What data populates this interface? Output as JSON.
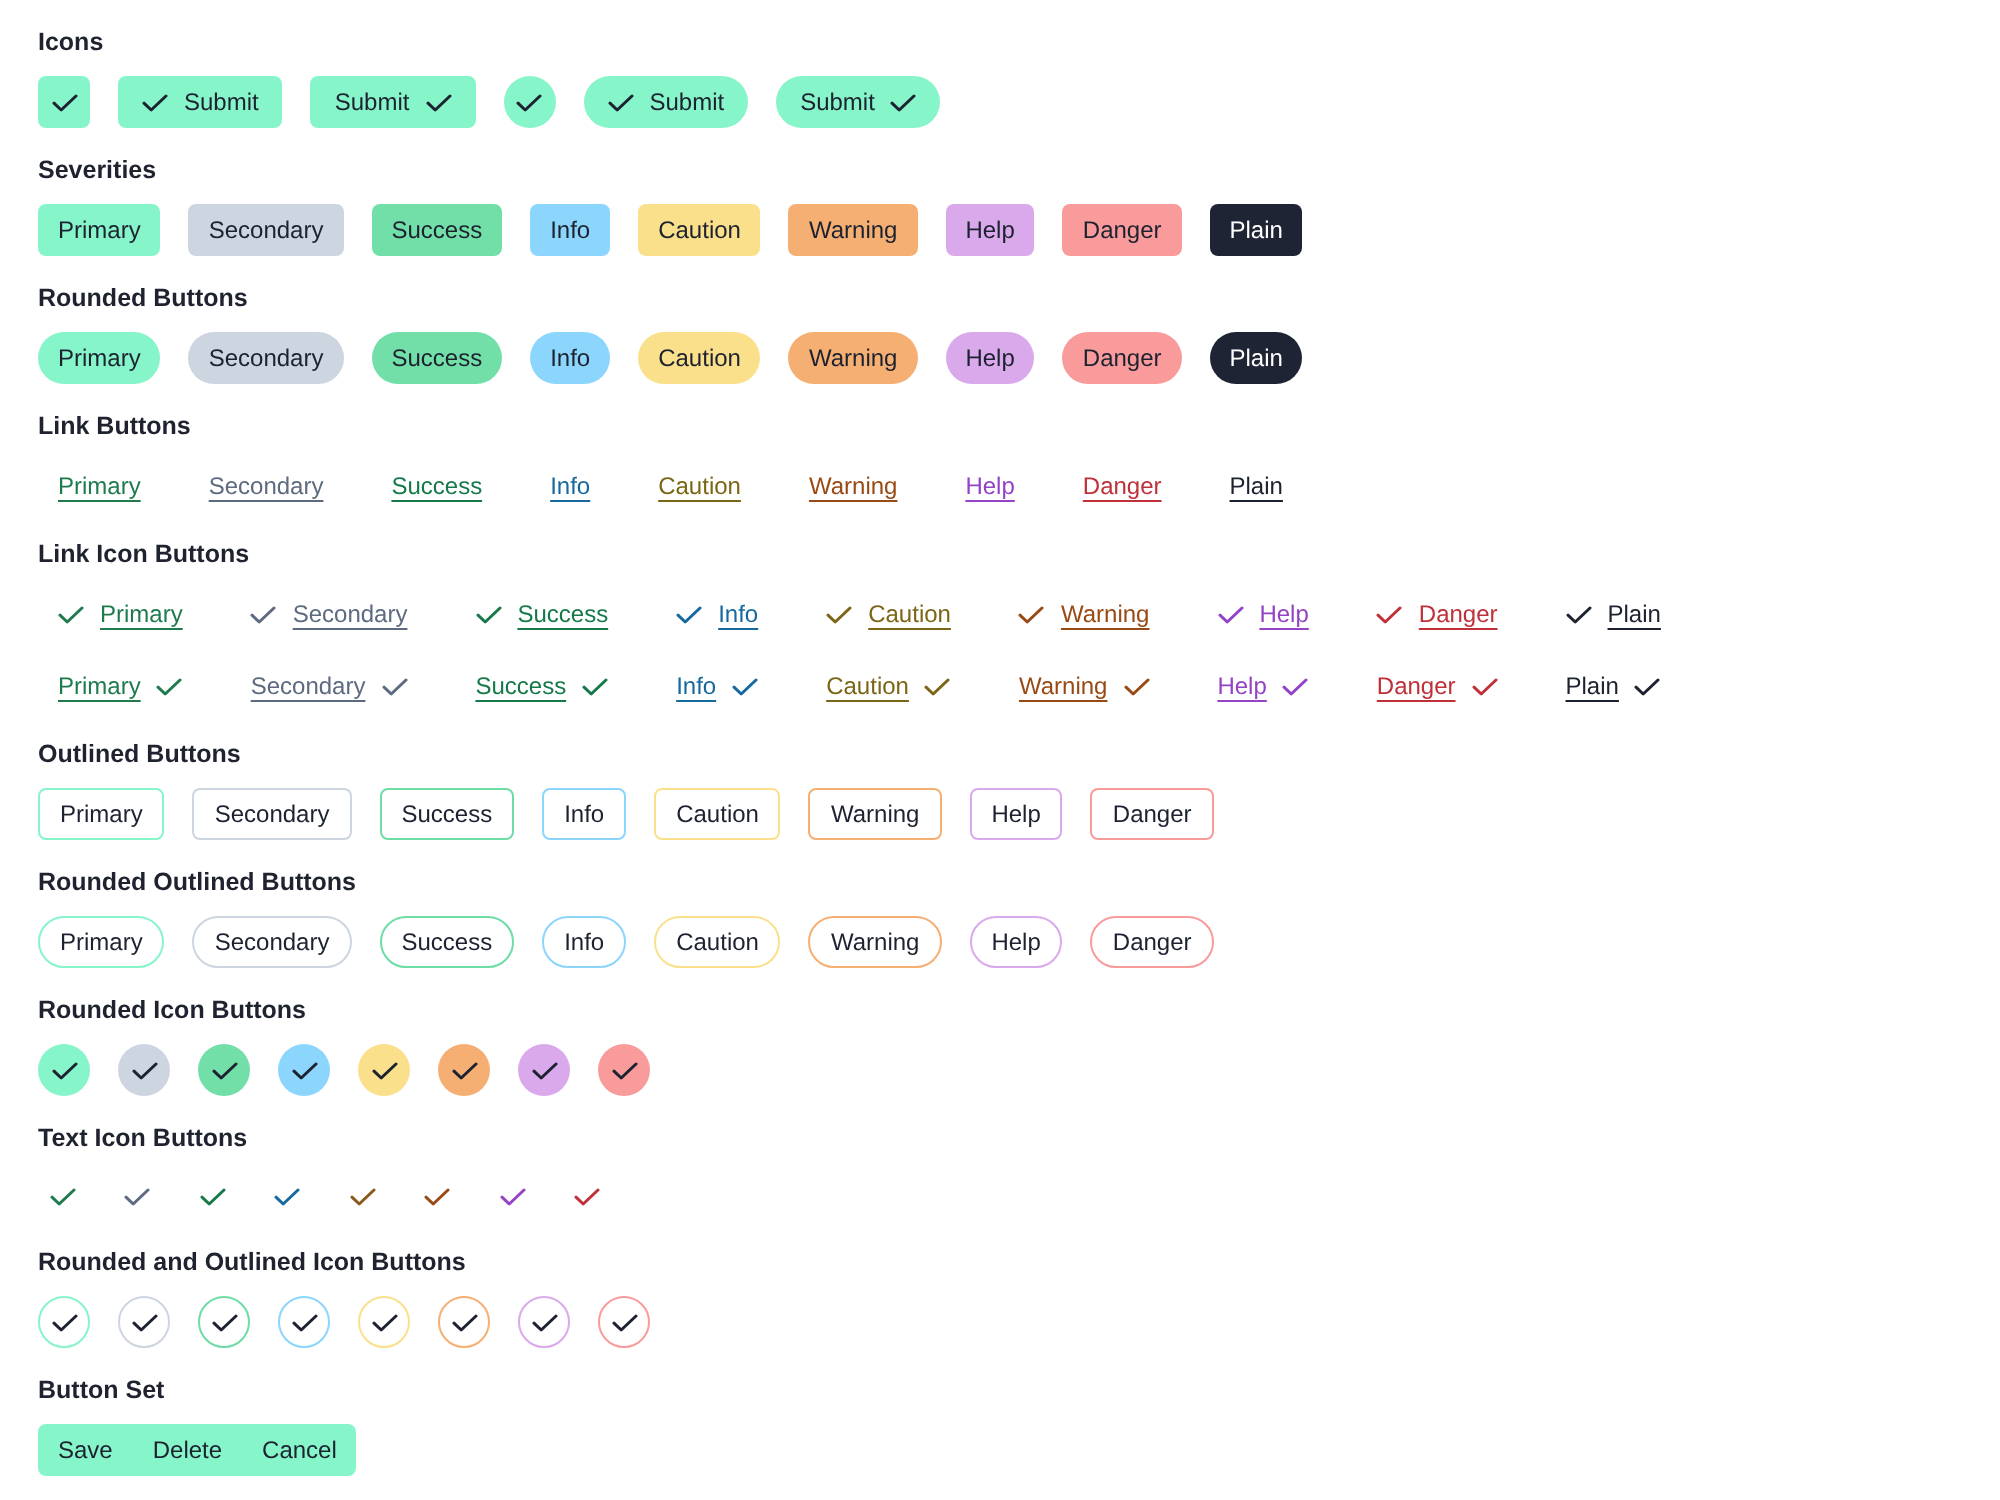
{
  "sections": [
    {
      "title": "Icons",
      "kind": "icons",
      "items": [
        {
          "kind": "icon"
        },
        {
          "kind": "icon-label",
          "label": "Submit"
        },
        {
          "kind": "label-icon",
          "label": "Submit"
        },
        {
          "kind": "round-icon"
        },
        {
          "kind": "round-icon-label",
          "label": "Submit"
        },
        {
          "kind": "round-label-icon",
          "label": "Submit"
        }
      ]
    },
    {
      "title": "Severities",
      "kind": "filled",
      "items": [
        {
          "label": "Primary",
          "color": "#86f5c9"
        },
        {
          "label": "Secondary",
          "color": "#cdd5e0"
        },
        {
          "label": "Success",
          "color": "#72dfa9"
        },
        {
          "label": "Info",
          "color": "#8cd5fc"
        },
        {
          "label": "Caution",
          "color": "#fbe08b"
        },
        {
          "label": "Warning",
          "color": "#f6af73"
        },
        {
          "label": "Help",
          "color": "#d9a9ec"
        },
        {
          "label": "Danger",
          "color": "#fa9b9b"
        },
        {
          "label": "Plain",
          "color": "#1e2433"
        }
      ]
    },
    {
      "title": "Rounded Buttons",
      "kind": "rounded",
      "items": [
        {
          "label": "Primary",
          "color": "#86f5c9"
        },
        {
          "label": "Secondary",
          "color": "#cdd5e0"
        },
        {
          "label": "Success",
          "color": "#72dfa9"
        },
        {
          "label": "Info",
          "color": "#8cd5fc"
        },
        {
          "label": "Caution",
          "color": "#fbe08b"
        },
        {
          "label": "Warning",
          "color": "#f6af73"
        },
        {
          "label": "Help",
          "color": "#d9a9ec"
        },
        {
          "label": "Danger",
          "color": "#fa9b9b"
        },
        {
          "label": "Plain",
          "color": "#1e2433"
        }
      ]
    },
    {
      "title": "Link Buttons",
      "kind": "link",
      "items": [
        {
          "label": "Primary",
          "color": "#1e7b4d"
        },
        {
          "label": "Secondary",
          "color": "#5d6a80"
        },
        {
          "label": "Success",
          "color": "#16794a"
        },
        {
          "label": "Info",
          "color": "#16699f"
        },
        {
          "label": "Caution",
          "color": "#7b6616"
        },
        {
          "label": "Warning",
          "color": "#994a14"
        },
        {
          "label": "Help",
          "color": "#9443c6"
        },
        {
          "label": "Danger",
          "color": "#bf3038"
        },
        {
          "label": "Plain",
          "color": "#1d2230"
        }
      ]
    },
    {
      "title": "Link Icon Buttons",
      "kind": "link",
      "rows": [
        {
          "kind": "icon-label",
          "items": [
            {
              "label": "Primary",
              "color": "#1e7b4d"
            },
            {
              "label": "Secondary",
              "color": "#5d6a80"
            },
            {
              "label": "Success",
              "color": "#16794a"
            },
            {
              "label": "Info",
              "color": "#16699f"
            },
            {
              "label": "Caution",
              "color": "#7b6616"
            },
            {
              "label": "Warning",
              "color": "#994a14"
            },
            {
              "label": "Help",
              "color": "#9443c6"
            },
            {
              "label": "Danger",
              "color": "#bf3038"
            },
            {
              "label": "Plain",
              "color": "#1d2230"
            }
          ]
        },
        {
          "kind": "label-icon",
          "items": [
            {
              "label": "Primary",
              "color": "#1e7b4d"
            },
            {
              "label": "Secondary",
              "color": "#5d6a80"
            },
            {
              "label": "Success",
              "color": "#16794a"
            },
            {
              "label": "Info",
              "color": "#16699f"
            },
            {
              "label": "Caution",
              "color": "#7b6616"
            },
            {
              "label": "Warning",
              "color": "#994a14"
            },
            {
              "label": "Help",
              "color": "#9443c6"
            },
            {
              "label": "Danger",
              "color": "#bf3038"
            },
            {
              "label": "Plain",
              "color": "#1d2230"
            }
          ]
        }
      ]
    },
    {
      "title": "Outlined Buttons",
      "kind": "outlined",
      "items": [
        {
          "label": "Primary",
          "color": "#86f5c9"
        },
        {
          "label": "Secondary",
          "color": "#cdd5e0"
        },
        {
          "label": "Success",
          "color": "#6ddca6"
        },
        {
          "label": "Info",
          "color": "#8cd5fc"
        },
        {
          "label": "Caution",
          "color": "#fbe08b"
        },
        {
          "label": "Warning",
          "color": "#f6af73"
        },
        {
          "label": "Help",
          "color": "#d9a9ec"
        },
        {
          "label": "Danger",
          "color": "#fa9b9b"
        }
      ]
    },
    {
      "title": "Rounded Outlined Buttons",
      "kind": "rounded-outlined",
      "items": [
        {
          "label": "Primary",
          "color": "#86f5c9"
        },
        {
          "label": "Secondary",
          "color": "#cdd5e0"
        },
        {
          "label": "Success",
          "color": "#6ddca6"
        },
        {
          "label": "Info",
          "color": "#8cd5fc"
        },
        {
          "label": "Caution",
          "color": "#fbe08b"
        },
        {
          "label": "Warning",
          "color": "#f6af73"
        },
        {
          "label": "Help",
          "color": "#d9a9ec"
        },
        {
          "label": "Danger",
          "color": "#fa9b9b"
        }
      ]
    },
    {
      "title": "Rounded Icon Buttons",
      "kind": "rounded-icon",
      "items": [
        {
          "color": "#86f5c9"
        },
        {
          "color": "#cdd5e0"
        },
        {
          "color": "#72dfa9"
        },
        {
          "color": "#8cd5fc"
        },
        {
          "color": "#fbe08b"
        },
        {
          "color": "#f6af73"
        },
        {
          "color": "#d9a9ec"
        },
        {
          "color": "#fa9b9b"
        }
      ]
    },
    {
      "title": "Text Icon Buttons",
      "kind": "text-icon",
      "items": [
        {
          "color": "#1e7b4d"
        },
        {
          "color": "#5d6a80"
        },
        {
          "color": "#16794a"
        },
        {
          "color": "#16699f"
        },
        {
          "color": "#8a5a1a"
        },
        {
          "color": "#994a14"
        },
        {
          "color": "#9443c6"
        },
        {
          "color": "#bf3038"
        }
      ]
    },
    {
      "title": "Rounded and Outlined Icon Buttons",
      "kind": "rounded-outlined-icon",
      "items": [
        {
          "color": "#86f5c9"
        },
        {
          "color": "#cdd5e0"
        },
        {
          "color": "#6ddca6"
        },
        {
          "color": "#8cd5fc"
        },
        {
          "color": "#fbe08b"
        },
        {
          "color": "#f6af73"
        },
        {
          "color": "#d9a9ec"
        },
        {
          "color": "#fa9b9b"
        }
      ]
    },
    {
      "title": "Button Set",
      "kind": "set",
      "items": [
        {
          "label": "Save"
        },
        {
          "label": "Delete"
        },
        {
          "label": "Cancel"
        }
      ]
    }
  ]
}
